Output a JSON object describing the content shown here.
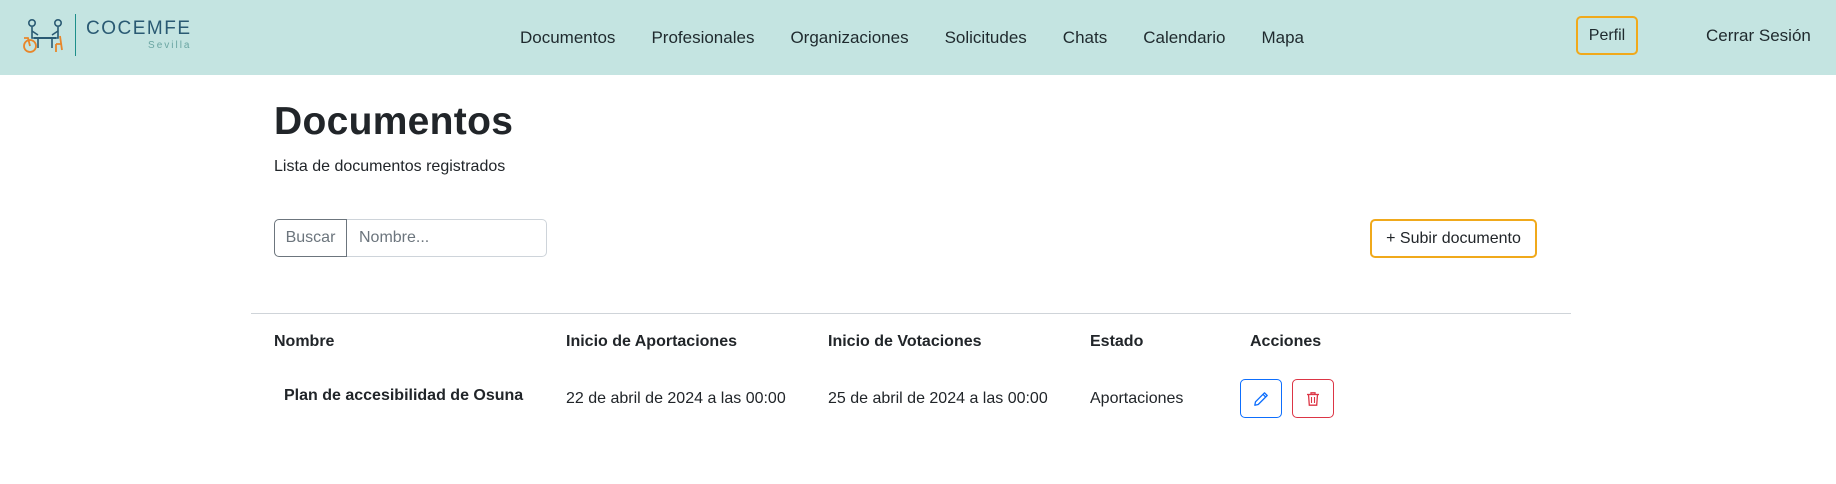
{
  "brand": {
    "title": "COCEMFE",
    "subtitle": "Sevilla"
  },
  "nav": {
    "links": [
      "Documentos",
      "Profesionales",
      "Organizaciones",
      "Solicitudes",
      "Chats",
      "Calendario",
      "Mapa"
    ],
    "profile_label": "Perfil",
    "logout_label": "Cerrar Sesión"
  },
  "page": {
    "title": "Documentos",
    "subtitle": "Lista de documentos registrados"
  },
  "search": {
    "button_label": "Buscar",
    "placeholder": "Nombre..."
  },
  "upload_label": "+ Subir documento",
  "table": {
    "headers": [
      "Nombre",
      "Inicio de Aportaciones",
      "Inicio de Votaciones",
      "Estado",
      "Acciones"
    ],
    "rows": [
      {
        "name": "Plan de accesibilidad de Osuna",
        "aportaciones": "22 de abril de 2024 a las 00:00",
        "votaciones": "25 de abril de 2024 a las 00:00",
        "estado": "Aportaciones"
      }
    ]
  },
  "colors": {
    "navbar_bg": "#c4e4e1",
    "accent": "#f0a91b",
    "edit": "#0d6efd",
    "delete": "#dc3545"
  },
  "icons": {
    "edit": "pencil-icon",
    "delete": "trash-icon"
  }
}
